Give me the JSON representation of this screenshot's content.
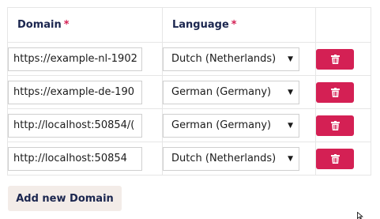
{
  "table": {
    "headers": {
      "domain": "Domain",
      "language": "Language",
      "required_marker": "*"
    },
    "rows": [
      {
        "domain": "https://example-nl-1902",
        "language": "Dutch (Netherlands)"
      },
      {
        "domain": "https://example-de-190",
        "language": "German (Germany)"
      },
      {
        "domain": "http://localhost:50854/(",
        "language": "German (Germany)"
      },
      {
        "domain": "http://localhost:50854",
        "language": "Dutch (Netherlands)"
      }
    ],
    "delete_icon": "trash-icon",
    "dropdown_icon": "caret-down-icon"
  },
  "actions": {
    "add_label": "Add new Domain"
  },
  "colors": {
    "accent": "#d42054",
    "heading": "#1b264f",
    "add_button_bg": "#f3ece8",
    "border": "#e6e6e6"
  }
}
